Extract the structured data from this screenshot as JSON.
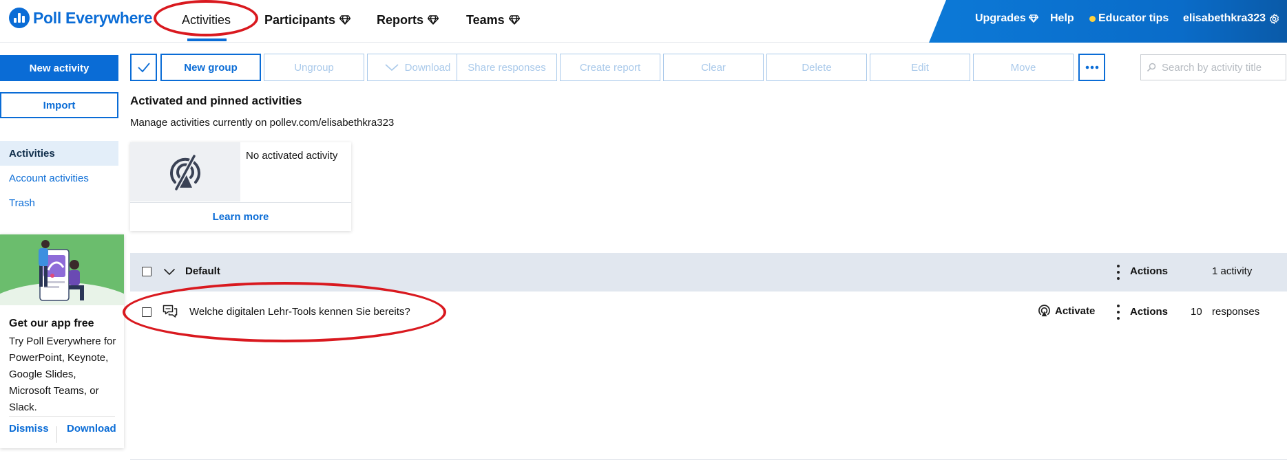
{
  "header": {
    "logo_text": "Poll Everywhere",
    "nav": [
      {
        "label": "Activities",
        "premium": false
      },
      {
        "label": "Participants",
        "premium": true
      },
      {
        "label": "Reports",
        "premium": true
      },
      {
        "label": "Teams",
        "premium": true
      }
    ],
    "upgrades": "Upgrades",
    "help": "Help",
    "educator_tips": "Educator tips",
    "username": "elisabethkra323",
    "accent_color": "#0a6cd6"
  },
  "sidebar": {
    "new_activity": "New activity",
    "import": "Import",
    "items": [
      {
        "label": "Activities",
        "active": true
      },
      {
        "label": "Account activities",
        "active": false
      },
      {
        "label": "Trash",
        "active": false
      }
    ],
    "promo": {
      "title": "Get our app free",
      "body": "Try Poll Everywhere for PowerPoint, Keynote, Google Slides, Microsoft Teams, or Slack.",
      "dismiss": "Dismiss",
      "download": "Download"
    }
  },
  "toolbar": {
    "new_group": "New group",
    "ungroup": "Ungroup",
    "download": "Download",
    "share_responses": "Share responses",
    "create_report": "Create report",
    "clear": "Clear",
    "delete": "Delete",
    "edit": "Edit",
    "move": "Move",
    "search_placeholder": "Search by activity title"
  },
  "main": {
    "section_title": "Activated and pinned activities",
    "section_subtitle": "Manage activities currently on pollev.com/elisabethkra323",
    "card": {
      "text": "No activated activity",
      "link": "Learn more"
    },
    "group": {
      "name": "Default",
      "actions": "Actions",
      "count": "1 activity"
    },
    "activities": [
      {
        "title": "Welche digitalen Lehr-Tools kennen Sie bereits?",
        "activate": "Activate",
        "actions": "Actions",
        "responses_count": "10",
        "responses_label": "responses"
      }
    ]
  }
}
